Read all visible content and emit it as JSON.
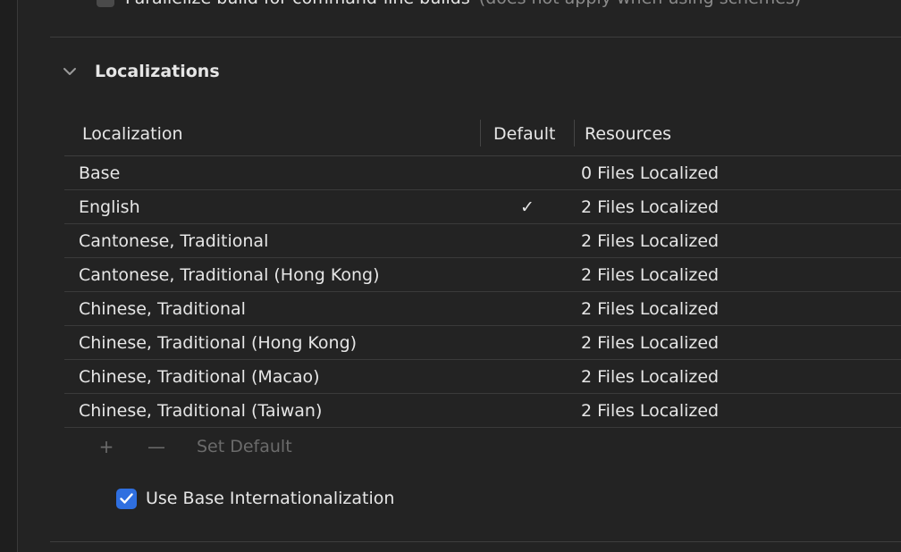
{
  "top_option": {
    "label": "Parallelize build for command-line builds",
    "note": "(does not apply when using schemes)",
    "checked": false
  },
  "localizations": {
    "title": "Localizations",
    "columns": {
      "localization": "Localization",
      "default": "Default",
      "resources": "Resources"
    },
    "rows": [
      {
        "name": "Base",
        "default": "",
        "resources": "0 Files Localized"
      },
      {
        "name": "English",
        "default": "✓",
        "resources": "2 Files Localized"
      },
      {
        "name": "Cantonese, Traditional",
        "default": "",
        "resources": "2 Files Localized"
      },
      {
        "name": "Cantonese, Traditional (Hong Kong)",
        "default": "",
        "resources": "2 Files Localized"
      },
      {
        "name": "Chinese, Traditional",
        "default": "",
        "resources": "2 Files Localized"
      },
      {
        "name": "Chinese, Traditional (Hong Kong)",
        "default": "",
        "resources": "2 Files Localized"
      },
      {
        "name": "Chinese, Traditional (Macao)",
        "default": "",
        "resources": "2 Files Localized"
      },
      {
        "name": "Chinese, Traditional (Taiwan)",
        "default": "",
        "resources": "2 Files Localized"
      }
    ],
    "toolbar": {
      "add_label": "+",
      "remove_label": "—",
      "set_default_label": "Set Default"
    },
    "base_internationalization": {
      "label": "Use Base Internationalization",
      "checked": true
    }
  },
  "colors": {
    "background": "#232323",
    "accent": "#2f6fe0",
    "disabled_text": "#6b6b6b"
  }
}
